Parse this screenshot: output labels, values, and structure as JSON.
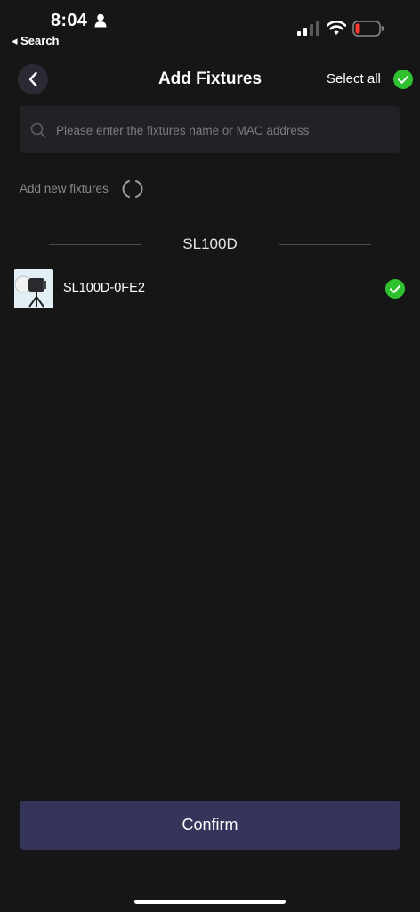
{
  "status_bar": {
    "time": "8:04",
    "back_app": "◂ Search",
    "icons": [
      "person-icon",
      "signal-icon",
      "wifi-icon",
      "battery-icon"
    ]
  },
  "header": {
    "title": "Add Fixtures",
    "select_all_label": "Select all",
    "back_icon": "chevron-left-icon"
  },
  "search": {
    "placeholder": "Please enter the fixtures name or MAC address",
    "value": ""
  },
  "add_new": {
    "label": "Add new fixtures"
  },
  "section": {
    "title": "SL100D",
    "items": [
      {
        "name": "SL100D-0FE2",
        "selected": true
      }
    ]
  },
  "footer": {
    "confirm_label": "Confirm"
  },
  "colors": {
    "background": "#161616",
    "check_green": "#2fc12f",
    "confirm_bg": "#35345a",
    "battery_low": "#ff3b30"
  }
}
